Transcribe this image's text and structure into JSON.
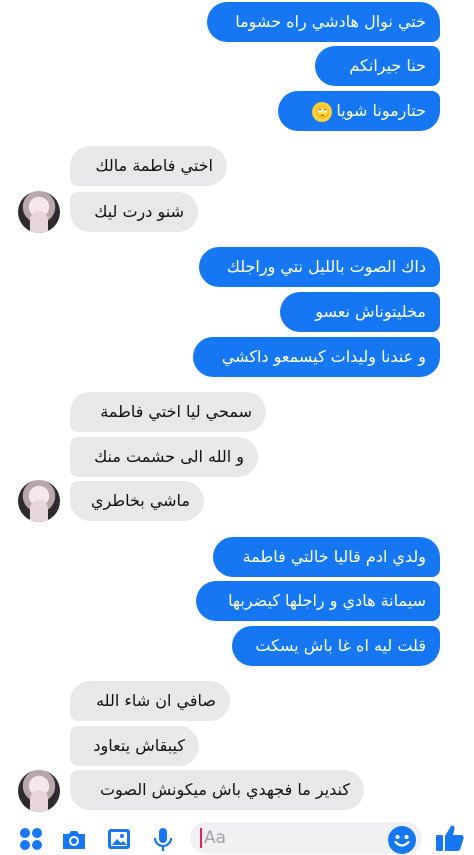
{
  "messages": [
    {
      "side": "out",
      "text": "ختي نوال هادشي راه حشوما"
    },
    {
      "side": "out",
      "text": "حنا جيرانكم"
    },
    {
      "side": "out",
      "text": "حتارمونا شويا",
      "emoji": "🙄"
    },
    {
      "side": "in",
      "text": "اختي فاطمة مالك"
    },
    {
      "side": "in",
      "text": "شنو درت ليك"
    },
    {
      "side": "out",
      "text": "داك الصوت بالليل نتي وراجلك"
    },
    {
      "side": "out",
      "text": "مخليتوناش نعسو"
    },
    {
      "side": "out",
      "text": "و عندنا وليدات كيسمعو داكشي"
    },
    {
      "side": "in",
      "text": "سمحي ليا اختي فاطمة"
    },
    {
      "side": "in",
      "text": "و الله الى حشمت منك"
    },
    {
      "side": "in",
      "text": "ماشي بخاطري"
    },
    {
      "side": "out",
      "text": "ولدي ادم قاليا خالتي فاطمة"
    },
    {
      "side": "out",
      "text": "سيمانة هادي و راجلها كيضربها"
    },
    {
      "side": "out",
      "text": "قلت ليه اه غا باش يسكت"
    },
    {
      "side": "in",
      "text": "صافي ان شاء الله"
    },
    {
      "side": "in",
      "text": "كيبقاش يتعاود"
    },
    {
      "side": "in",
      "text": "كندير ما فجهدي باش ميكونش الصوت"
    }
  ],
  "composer": {
    "placeholder": "Aa",
    "icons": [
      "apps-icon",
      "camera-icon",
      "gallery-icon",
      "microphone-icon",
      "emoji-icon",
      "like-icon"
    ]
  },
  "colors": {
    "outgoing": "#1677f2",
    "incoming": "#e8e8eb"
  }
}
